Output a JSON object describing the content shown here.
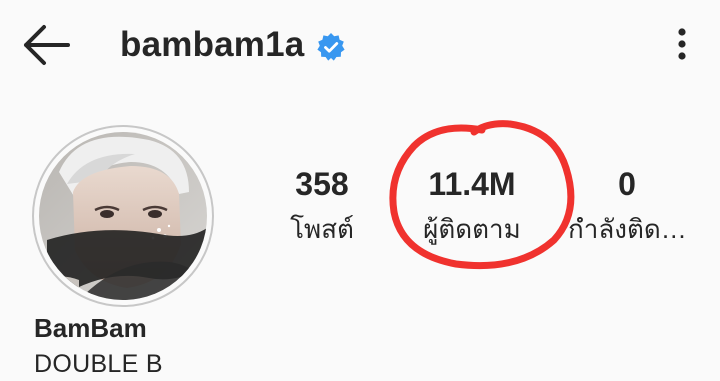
{
  "header": {
    "username": "bambam1a",
    "verified": true,
    "icons": {
      "back": "back-arrow-icon",
      "verified": "verified-badge-icon",
      "more": "more-options-icon"
    }
  },
  "profile": {
    "display_name": "BamBam",
    "bio": "DOUBLE B"
  },
  "stats": {
    "posts": {
      "value": "358",
      "label": "โพสต์"
    },
    "followers": {
      "value": "11.4M",
      "label": "ผู้ติดตาม"
    },
    "following": {
      "value": "0",
      "label": "กำลังติดตาม"
    }
  },
  "colors": {
    "background": "#fafafa",
    "text": "#262626",
    "verified_blue": "#3897f0",
    "annotation_red": "#f0322e"
  }
}
